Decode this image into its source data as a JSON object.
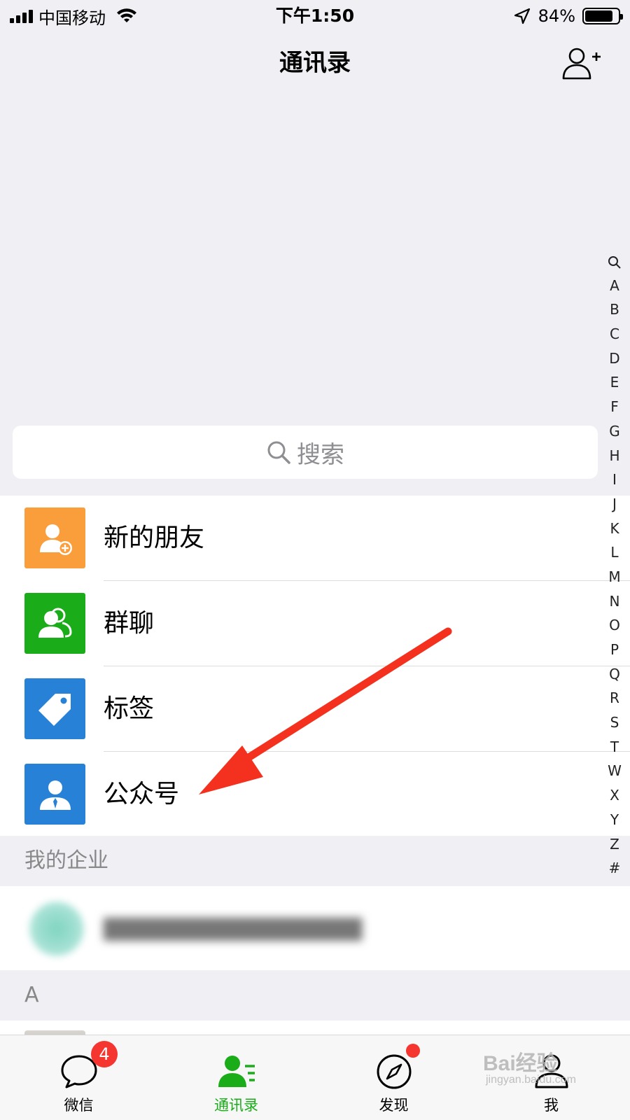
{
  "status_bar": {
    "carrier": "中国移动",
    "time": "下午1:50",
    "battery_percent": "84%",
    "battery_level": 0.84,
    "icons": [
      "signal-icon",
      "wifi-icon",
      "location-icon",
      "battery-icon"
    ]
  },
  "nav": {
    "title": "通讯录",
    "add_contact_icon": "add-contact-icon"
  },
  "search": {
    "placeholder": "搜索"
  },
  "functions": [
    {
      "label": "新的朋友",
      "icon": "new-friend-icon",
      "color": "#fa9d3b"
    },
    {
      "label": "群聊",
      "icon": "group-chat-icon",
      "color": "#1aad19"
    },
    {
      "label": "标签",
      "icon": "tag-icon",
      "color": "#2782d7"
    },
    {
      "label": "公众号",
      "icon": "official-account-icon",
      "color": "#2782d7"
    }
  ],
  "enterprise": {
    "section_label": "我的企业"
  },
  "contacts": {
    "section_label": "A"
  },
  "index_letters": [
    "A",
    "B",
    "C",
    "D",
    "E",
    "F",
    "G",
    "H",
    "I",
    "J",
    "K",
    "L",
    "M",
    "N",
    "O",
    "P",
    "Q",
    "R",
    "S",
    "T",
    "W",
    "X",
    "Y",
    "Z",
    "#"
  ],
  "annotation": {
    "color": "#f4311e"
  },
  "tabs": [
    {
      "label": "微信",
      "icon": "chat-icon",
      "badge": "4"
    },
    {
      "label": "通讯录",
      "icon": "contacts-icon",
      "active": true
    },
    {
      "label": "发现",
      "icon": "compass-icon",
      "dot": true
    },
    {
      "label": "我",
      "icon": "me-icon"
    }
  ],
  "watermark": {
    "text": "Bai经验",
    "sub": "jingyan.baidu.com"
  },
  "colors": {
    "background": "#efeff4",
    "accent_green": "#1aad19",
    "badge_red": "#f43530"
  }
}
